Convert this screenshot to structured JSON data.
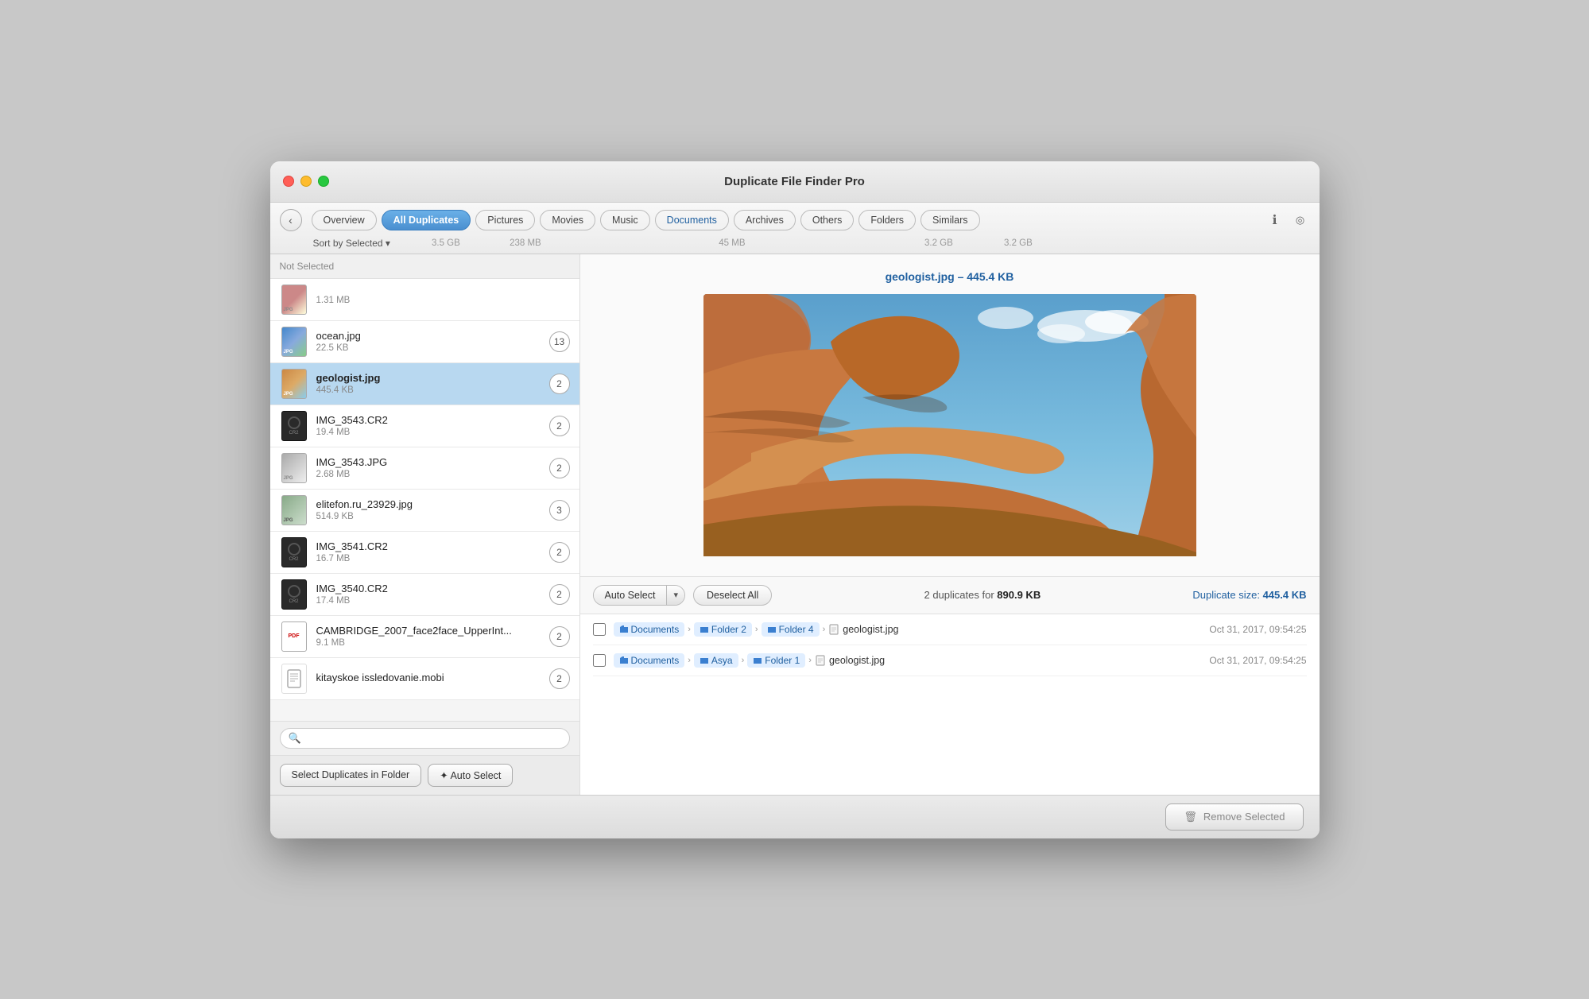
{
  "window": {
    "title": "Duplicate File Finder Pro"
  },
  "toolbar": {
    "back_label": "‹",
    "tabs": [
      {
        "id": "overview",
        "label": "Overview",
        "size": "",
        "active": false
      },
      {
        "id": "all-duplicates",
        "label": "All Duplicates",
        "size": "3.5 GB",
        "active": true
      },
      {
        "id": "pictures",
        "label": "Pictures",
        "size": "238 MB",
        "active": false
      },
      {
        "id": "movies",
        "label": "Movies",
        "size": "",
        "active": false
      },
      {
        "id": "music",
        "label": "Music",
        "size": "",
        "active": false
      },
      {
        "id": "documents",
        "label": "Documents",
        "size": "45 MB",
        "active": false
      },
      {
        "id": "archives",
        "label": "Archives",
        "size": "",
        "active": false
      },
      {
        "id": "others",
        "label": "Others",
        "size": "",
        "active": false
      },
      {
        "id": "folders",
        "label": "Folders",
        "size": "3.2 GB",
        "active": false
      },
      {
        "id": "similars",
        "label": "Similars",
        "size": "3.2 GB",
        "active": false
      }
    ],
    "sort_label": "Sort by Selected ▾",
    "info_icon": "ℹ",
    "rss_icon": "◎"
  },
  "sidebar": {
    "header_label": "Not Selected",
    "search_placeholder": "",
    "files": [
      {
        "id": "prev",
        "name": "...",
        "size": "1.31 MB",
        "count": "",
        "type": "jpg",
        "selected": false,
        "truncated": true
      },
      {
        "id": "ocean",
        "name": "ocean.jpg",
        "size": "22.5 KB",
        "count": "13",
        "type": "jpg",
        "selected": false
      },
      {
        "id": "geologist",
        "name": "geologist.jpg",
        "size": "445.4 KB",
        "count": "2",
        "type": "jpg",
        "selected": true
      },
      {
        "id": "img3543cr2",
        "name": "IMG_3543.CR2",
        "size": "19.4 MB",
        "count": "2",
        "type": "cr2",
        "selected": false
      },
      {
        "id": "img3543jpg",
        "name": "IMG_3543.JPG",
        "size": "2.68 MB",
        "count": "2",
        "type": "jpg",
        "selected": false
      },
      {
        "id": "elitefon",
        "name": "elitefon.ru_23929.jpg",
        "size": "514.9 KB",
        "count": "3",
        "type": "jpg",
        "selected": false
      },
      {
        "id": "img3541",
        "name": "IMG_3541.CR2",
        "size": "16.7 MB",
        "count": "2",
        "type": "cr2",
        "selected": false
      },
      {
        "id": "img3540",
        "name": "IMG_3540.CR2",
        "size": "17.4 MB",
        "count": "2",
        "type": "cr2",
        "selected": false
      },
      {
        "id": "cambridge",
        "name": "CAMBRIDGE_2007_face2face_UpperInt...",
        "size": "9.1 MB",
        "count": "2",
        "type": "pdf",
        "selected": false
      },
      {
        "id": "kitayskoe",
        "name": "kitayskoe issledovanie.mobi",
        "size": "",
        "count": "2",
        "type": "mobi",
        "selected": false
      }
    ],
    "select_duplicates_label": "Select Duplicates in Folder",
    "auto_select_label": "✦ Auto Select"
  },
  "detail": {
    "preview_title": "geologist.jpg – 445.4 KB",
    "auto_select_label": "Auto Select",
    "deselect_all_label": "Deselect All",
    "duplicates_count_text": "2 duplicates for",
    "duplicates_size": "890.9 KB",
    "duplicate_size_label": "Duplicate size:",
    "duplicate_size_value": "445.4 KB",
    "rows": [
      {
        "id": "row1",
        "checked": false,
        "path": [
          {
            "type": "folder",
            "label": "Documents"
          },
          {
            "type": "folder",
            "label": "Folder 2"
          },
          {
            "type": "folder",
            "label": "Folder 4"
          },
          {
            "type": "file",
            "label": "geologist.jpg"
          }
        ],
        "date": "Oct 31, 2017, 09:54:25"
      },
      {
        "id": "row2",
        "checked": false,
        "path": [
          {
            "type": "folder",
            "label": "Documents"
          },
          {
            "type": "folder",
            "label": "Asya"
          },
          {
            "type": "folder",
            "label": "Folder 1"
          },
          {
            "type": "file",
            "label": "geologist.jpg"
          }
        ],
        "date": "Oct 31, 2017, 09:54:25"
      }
    ]
  },
  "bottom_bar": {
    "remove_label": "Remove Selected",
    "trash_icon": "🗑"
  }
}
